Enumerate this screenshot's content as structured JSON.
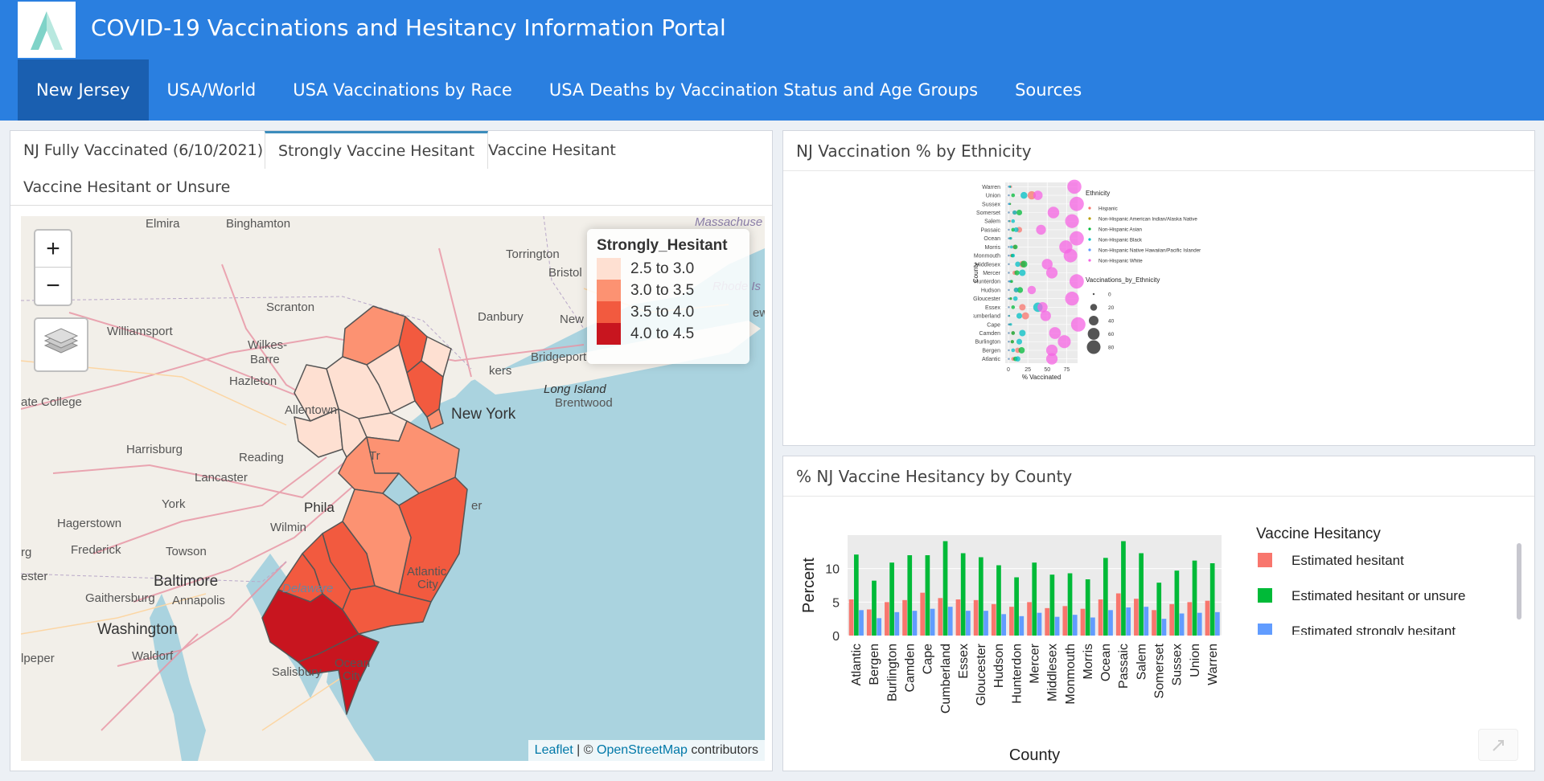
{
  "app": {
    "title": "COVID-19 Vaccinations and Hesitancy Information Portal"
  },
  "nav": [
    {
      "label": "New Jersey"
    },
    {
      "label": "USA/World"
    },
    {
      "label": "USA Vaccinations by Race"
    },
    {
      "label": "USA Deaths by Vaccination Status and Age Groups"
    },
    {
      "label": "Sources"
    }
  ],
  "map_panel": {
    "tabs": [
      {
        "label": "NJ Fully Vaccinated (6/10/2021)"
      },
      {
        "label": "Strongly Vaccine Hesitant"
      },
      {
        "label": "Vaccine Hesitant"
      },
      {
        "label": "Vaccine Hesitant or Unsure"
      }
    ],
    "zoom_in": "+",
    "zoom_out": "−",
    "legend_title": "Strongly_Hesitant",
    "legend": [
      {
        "label": "2.5 to 3.0",
        "color": "#fee0d2"
      },
      {
        "label": "3.0 to 3.5",
        "color": "#fc9272"
      },
      {
        "label": "3.5 to 4.0",
        "color": "#f25a3f"
      },
      {
        "label": "4.0 to 4.5",
        "color": "#c8151f"
      }
    ],
    "attribution_leaflet": "Leaflet",
    "attribution_sep": " | © ",
    "attribution_osm": "OpenStreetMap",
    "attribution_rest": " contributors",
    "places": {
      "elmira": "Elmira",
      "binghamton": "Binghamton",
      "massachusetts": "Massachuse",
      "torrington": "Torrington",
      "bristol": "Bristol",
      "rhode": "Rhode Is",
      "williamsport": "Williamsport",
      "scranton": "Scranton",
      "danbury": "Danbury",
      "newhaven": "New",
      "wilkesbarre1": "Wilkes-",
      "wilkesbarre2": "Barre",
      "bridgeport": "Bridgeport",
      "hazleton": "Hazleton",
      "longisland": "Long Island",
      "statecollege": "ate College",
      "allentown": "Allentown",
      "newyork": "New York",
      "brentwood": "Brentwood",
      "harrisburg": "Harrisburg",
      "reading": "Reading",
      "lancaster": "Lancaster",
      "york": "York",
      "phila": "Phila",
      "hagerstown": "Hagerstown",
      "wilmington": "Wilmin",
      "frederick": "Frederick",
      "towson": "Towson",
      "baltimore": "Baltimore",
      "gaithersburg": "Gaithersburg",
      "annapolis": "Annapolis",
      "delaware": "Delaware",
      "washington": "Washington",
      "waldorf": "Waldorf",
      "salisbury": "Salisbury",
      "oceancity1": "Ocean",
      "oceancity2": "City",
      "atlanticcity1": "Atlantic",
      "atlanticcity2": "City",
      "pepper": "lpeper",
      "ester": "ester",
      "rg": "rg",
      "tr": "Tr",
      "er": "er",
      "kers": "kers",
      "ew": "ew"
    }
  },
  "ethnicity_panel": {
    "title": "NJ Vaccination % by Ethnicity",
    "chart_data": {
      "type": "scatter",
      "title": "",
      "xlabel": "% Vaccinated",
      "ylabel": "County",
      "xlim": [
        0,
        85
      ],
      "xticks": [
        "0",
        "25",
        "50",
        "75"
      ],
      "counties": [
        "Warren",
        "Union",
        "Sussex",
        "Somerset",
        "Salem",
        "Passaic",
        "Ocean",
        "Morris",
        "Monmouth",
        "Middlesex",
        "Mercer",
        "Hunterdon",
        "Hudson",
        "Gloucester",
        "Essex",
        "Cumberland",
        "Cape",
        "Camden",
        "Burlington",
        "Bergen",
        "Atlantic"
      ],
      "legend_ethnicity_title": "Ethnicity",
      "series": [
        {
          "name": "Hispanic",
          "color": "#f8766d",
          "values": [
            3,
            30,
            2,
            8,
            2,
            14,
            3,
            8,
            4,
            18,
            8,
            3,
            10,
            3,
            18,
            22,
            2,
            6,
            5,
            12,
            6
          ]
        },
        {
          "name": "Non-Hispanic American Indian/Alaska Native",
          "color": "#b79f00",
          "values": [
            0.5,
            0.5,
            0.5,
            0.5,
            0.5,
            0.5,
            0.5,
            0.5,
            0.5,
            0.5,
            0.5,
            0.5,
            0.5,
            0.5,
            0.5,
            0.5,
            0.5,
            0.5,
            0.5,
            0.5,
            0.5
          ]
        },
        {
          "name": "Non-Hispanic Asian",
          "color": "#00ba38",
          "values": [
            2,
            6,
            2,
            14,
            1,
            6,
            2,
            9,
            5,
            20,
            11,
            4,
            15,
            3,
            6,
            1,
            1,
            6,
            5,
            17,
            9
          ]
        },
        {
          "name": "Non-Hispanic Black",
          "color": "#00bfc4",
          "values": [
            2,
            20,
            1,
            8,
            6,
            10,
            3,
            4,
            6,
            12,
            18,
            2,
            10,
            9,
            38,
            14,
            3,
            18,
            14,
            6,
            12
          ]
        },
        {
          "name": "Non-Hispanic Native Hawaiian/Pacific Islander",
          "color": "#619cff",
          "values": [
            0.5,
            0.5,
            0.5,
            0.5,
            0.5,
            0.5,
            0.5,
            0.5,
            0.5,
            0.5,
            0.5,
            0.5,
            0.5,
            0.5,
            0.5,
            0.5,
            0.5,
            0.5,
            0.5,
            0.5,
            0.5
          ]
        },
        {
          "name": "Non-Hispanic White",
          "color": "#f564e3",
          "values": [
            85,
            38,
            88,
            58,
            82,
            42,
            88,
            74,
            80,
            50,
            56,
            88,
            30,
            82,
            44,
            48,
            90,
            60,
            72,
            56,
            56
          ]
        }
      ],
      "legend_size_title": "Vaccinations_by_Ethnicity",
      "size_legend": [
        "0",
        "20",
        "40",
        "60",
        "80"
      ]
    }
  },
  "hesitancy_panel": {
    "title": "% NJ Vaccine Hesitancy by County",
    "chart_data": {
      "type": "bar",
      "xlabel": "County",
      "ylabel": "Percent",
      "ylim": [
        0,
        15
      ],
      "yticks": [
        "0",
        "5",
        "10"
      ],
      "legend_title": "Vaccine Hesitancy",
      "categories": [
        "Atlantic",
        "Bergen",
        "Burlington",
        "Camden",
        "Cape",
        "Cumberland",
        "Essex",
        "Gloucester",
        "Hudson",
        "Hunterdon",
        "Mercer",
        "Middlesex",
        "Monmouth",
        "Morris",
        "Ocean",
        "Passaic",
        "Salem",
        "Somerset",
        "Sussex",
        "Union",
        "Warren"
      ],
      "series": [
        {
          "name": "Estimated hesitant",
          "color": "#f8766d",
          "values": [
            5.4,
            3.9,
            5.0,
            5.3,
            6.4,
            5.6,
            5.4,
            5.3,
            4.7,
            4.3,
            5.0,
            4.1,
            4.4,
            4.0,
            5.4,
            6.3,
            5.5,
            3.8,
            4.7,
            5.0,
            5.2
          ]
        },
        {
          "name": "Estimated hesitant or unsure",
          "color": "#00ba38",
          "values": [
            12.1,
            8.2,
            10.9,
            12.0,
            12.0,
            14.1,
            12.3,
            11.7,
            10.5,
            8.7,
            10.9,
            9.1,
            9.3,
            8.4,
            11.6,
            14.1,
            12.3,
            7.9,
            9.7,
            11.2,
            10.8
          ]
        },
        {
          "name": "Estimated strongly hesitant",
          "color": "#619cff",
          "values": [
            3.8,
            2.6,
            3.5,
            3.7,
            4.0,
            4.3,
            3.7,
            3.7,
            3.2,
            2.9,
            3.4,
            2.8,
            3.1,
            2.7,
            3.8,
            4.2,
            4.3,
            2.5,
            3.3,
            3.4,
            3.5
          ]
        }
      ]
    }
  }
}
